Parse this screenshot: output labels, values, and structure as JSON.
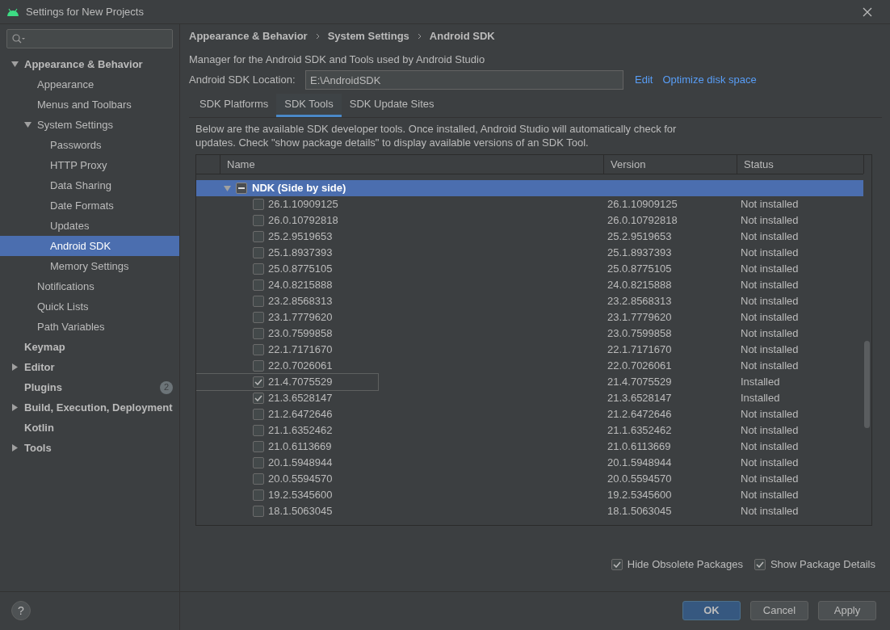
{
  "window": {
    "title": "Settings for New Projects"
  },
  "sidebar": {
    "items": [
      {
        "label": "Appearance & Behavior",
        "expanded": true,
        "selected": false,
        "children": [
          {
            "label": "Appearance",
            "selected": false
          },
          {
            "label": "Menus and Toolbars",
            "selected": false
          },
          {
            "label": "System Settings",
            "expanded": true,
            "selected": false,
            "children": [
              {
                "label": "Passwords",
                "selected": false
              },
              {
                "label": "HTTP Proxy",
                "selected": false
              },
              {
                "label": "Data Sharing",
                "selected": false
              },
              {
                "label": "Date Formats",
                "selected": false
              },
              {
                "label": "Updates",
                "selected": false
              },
              {
                "label": "Android SDK",
                "selected": true
              },
              {
                "label": "Memory Settings",
                "selected": false
              }
            ]
          },
          {
            "label": "Notifications",
            "selected": false
          },
          {
            "label": "Quick Lists",
            "selected": false
          },
          {
            "label": "Path Variables",
            "selected": false
          }
        ]
      },
      {
        "label": "Keymap",
        "selected": false
      },
      {
        "label": "Editor",
        "expanded": false,
        "selected": false
      },
      {
        "label": "Plugins",
        "selected": false,
        "badge": "2"
      },
      {
        "label": "Build, Execution, Deployment",
        "expanded": false,
        "selected": false
      },
      {
        "label": "Kotlin",
        "selected": false
      },
      {
        "label": "Tools",
        "expanded": false,
        "selected": false
      }
    ]
  },
  "breadcrumb": [
    "Appearance & Behavior",
    "System Settings",
    "Android SDK"
  ],
  "description": "Manager for the Android SDK and Tools used by Android Studio",
  "sdk_location": {
    "label": "Android SDK Location:",
    "value": "E:\\AndroidSDK",
    "links": [
      "Edit",
      "Optimize disk space"
    ]
  },
  "tabs": [
    {
      "label": "SDK Platforms",
      "selected": false
    },
    {
      "label": "SDK Tools",
      "selected": true
    },
    {
      "label": "SDK Update Sites",
      "selected": false
    }
  ],
  "info": "Below are the available SDK developer tools. Once installed, Android Studio will automatically check for updates. Check \"show package details\" to display available versions of an SDK Tool.",
  "table": {
    "columns": [
      "Name",
      "Version",
      "Status"
    ],
    "rows": [
      {
        "name": "NDK (Side by side)",
        "expanded": true,
        "partially_checked": true,
        "selected": true,
        "children": [
          {
            "name": "26.1.10909125",
            "version": "26.1.10909125",
            "status": "Not installed",
            "checked": false,
            "outlined": false
          },
          {
            "name": "26.0.10792818",
            "version": "26.0.10792818",
            "status": "Not installed",
            "checked": false,
            "outlined": false
          },
          {
            "name": "25.2.9519653",
            "version": "25.2.9519653",
            "status": "Not installed",
            "checked": false,
            "outlined": false
          },
          {
            "name": "25.1.8937393",
            "version": "25.1.8937393",
            "status": "Not installed",
            "checked": false,
            "outlined": false
          },
          {
            "name": "25.0.8775105",
            "version": "25.0.8775105",
            "status": "Not installed",
            "checked": false,
            "outlined": false
          },
          {
            "name": "24.0.8215888",
            "version": "24.0.8215888",
            "status": "Not installed",
            "checked": false,
            "outlined": false
          },
          {
            "name": "23.2.8568313",
            "version": "23.2.8568313",
            "status": "Not installed",
            "checked": false,
            "outlined": false
          },
          {
            "name": "23.1.7779620",
            "version": "23.1.7779620",
            "status": "Not installed",
            "checked": false,
            "outlined": false
          },
          {
            "name": "23.0.7599858",
            "version": "23.0.7599858",
            "status": "Not installed",
            "checked": false,
            "outlined": false
          },
          {
            "name": "22.1.7171670",
            "version": "22.1.7171670",
            "status": "Not installed",
            "checked": false,
            "outlined": false
          },
          {
            "name": "22.0.7026061",
            "version": "22.0.7026061",
            "status": "Not installed",
            "checked": false,
            "outlined": false
          },
          {
            "name": "21.4.7075529",
            "version": "21.4.7075529",
            "status": "Installed",
            "checked": true,
            "outlined": true
          },
          {
            "name": "21.3.6528147",
            "version": "21.3.6528147",
            "status": "Installed",
            "checked": true,
            "outlined": false
          },
          {
            "name": "21.2.6472646",
            "version": "21.2.6472646",
            "status": "Not installed",
            "checked": false,
            "outlined": false
          },
          {
            "name": "21.1.6352462",
            "version": "21.1.6352462",
            "status": "Not installed",
            "checked": false,
            "outlined": false
          },
          {
            "name": "21.0.6113669",
            "version": "21.0.6113669",
            "status": "Not installed",
            "checked": false,
            "outlined": false
          },
          {
            "name": "20.1.5948944",
            "version": "20.1.5948944",
            "status": "Not installed",
            "checked": false,
            "outlined": false
          },
          {
            "name": "20.0.5594570",
            "version": "20.0.5594570",
            "status": "Not installed",
            "checked": false,
            "outlined": false
          },
          {
            "name": "19.2.5345600",
            "version": "19.2.5345600",
            "status": "Not installed",
            "checked": false,
            "outlined": false
          },
          {
            "name": "18.1.5063045",
            "version": "18.1.5063045",
            "status": "Not installed",
            "checked": false,
            "outlined": false
          }
        ]
      }
    ]
  },
  "options": [
    {
      "label": "Hide Obsolete Packages",
      "checked": true
    },
    {
      "label": "Show Package Details",
      "checked": true
    }
  ],
  "buttons": [
    {
      "label": "OK",
      "default": true
    },
    {
      "label": "Cancel",
      "default": false
    },
    {
      "label": "Apply",
      "default": false
    }
  ],
  "help": "?"
}
